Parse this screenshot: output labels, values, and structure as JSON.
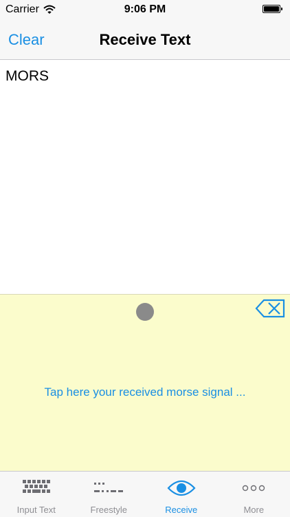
{
  "status_bar": {
    "carrier": "Carrier",
    "time": "9:06 PM",
    "battery_level": 1.0
  },
  "nav_bar": {
    "clear_label": "Clear",
    "title": "Receive Text"
  },
  "received": {
    "text": "MORS"
  },
  "signal_pad": {
    "hint": "Tap here your received morse signal ...",
    "background_color": "#fbfccc"
  },
  "colors": {
    "accent": "#1a8fe3",
    "inactive_tab": "#8e8e93"
  },
  "tabs": [
    {
      "label": "Input Text",
      "icon": "keyboard-icon",
      "active": false
    },
    {
      "label": "Freestyle",
      "icon": "morse-dots-icon",
      "active": false
    },
    {
      "label": "Receive",
      "icon": "eye-icon",
      "active": true
    },
    {
      "label": "More",
      "icon": "more-icon",
      "active": false
    }
  ]
}
